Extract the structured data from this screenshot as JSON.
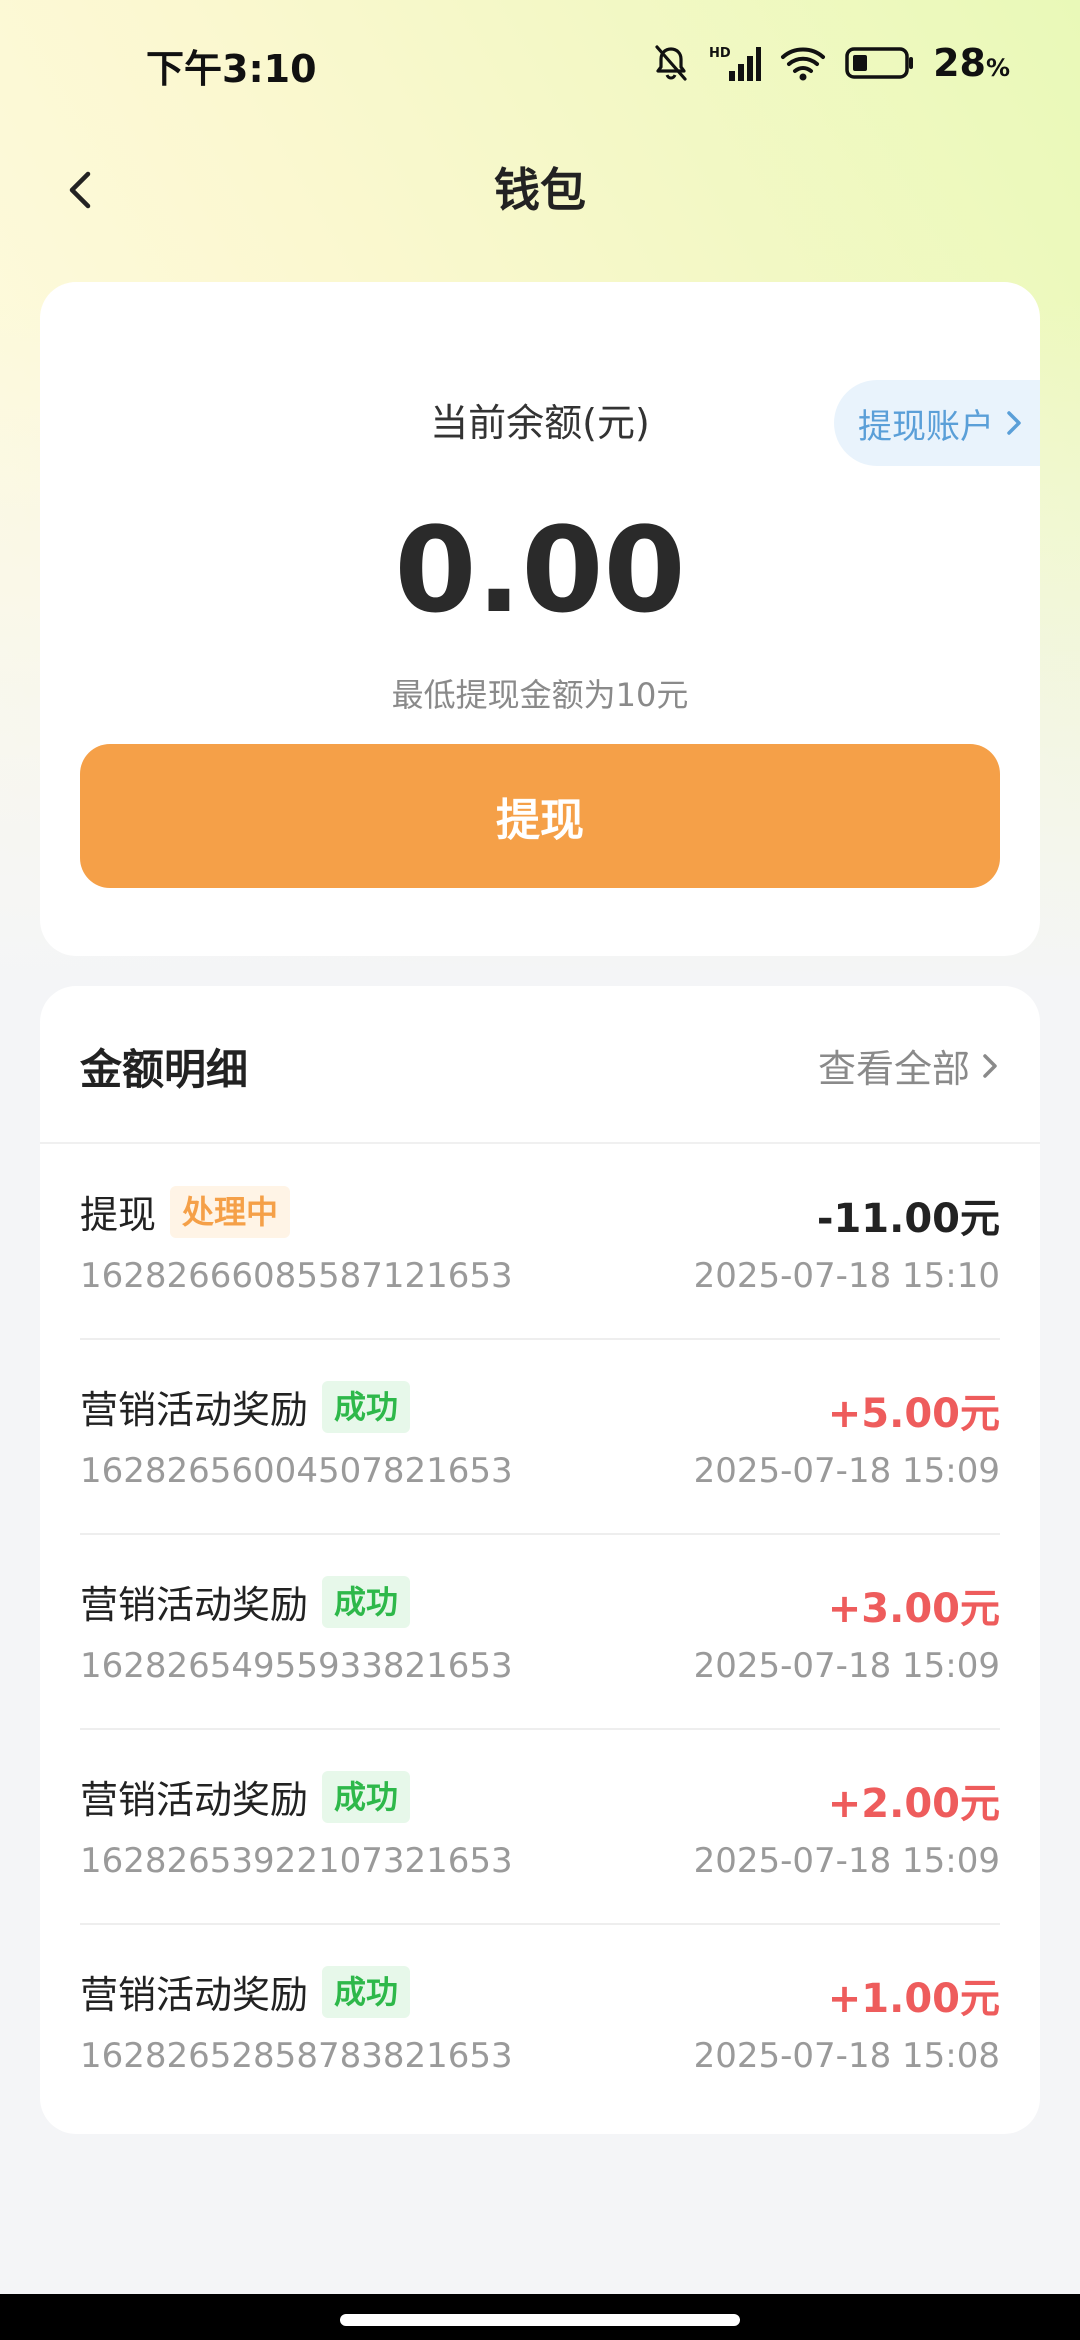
{
  "status_bar": {
    "time": "下午3:10",
    "network": "HD",
    "battery": "28",
    "battery_unit": "%"
  },
  "nav": {
    "title": "钱包"
  },
  "balance": {
    "label": "当前余额(元)",
    "value": "0.00",
    "min_withdraw_note": "最低提现金额为10元",
    "withdraw_account_label": "提现账户",
    "withdraw_button_label": "提现"
  },
  "details": {
    "title": "金额明细",
    "view_all_label": "查看全部",
    "records": [
      {
        "title": "提现",
        "status": "处理中",
        "id": "1628266608558712165​3",
        "amount": "-11.00元",
        "time": "2025-07-18 15:10"
      },
      {
        "title": "营销活动奖励",
        "status": "成功",
        "id": "1628265600450782165​3",
        "amount": "+5.00元",
        "time": "2025-07-18 15:09"
      },
      {
        "title": "营销活动奖励",
        "status": "成功",
        "id": "1628265495593382165​3",
        "amount": "+3.00元",
        "time": "2025-07-18 15:09"
      },
      {
        "title": "营销活动奖励",
        "status": "成功",
        "id": "1628265392210732165​3",
        "amount": "+2.00元",
        "time": "2025-07-18 15:09"
      },
      {
        "title": "营销活动奖励",
        "status": "成功",
        "id": "1628265285878382165​3",
        "amount": "+1.00元",
        "time": "2025-07-18 15:08"
      }
    ]
  },
  "colors": {
    "accent": "#f5a048",
    "positive_amount": "#ee5c5c",
    "success_badge": "#2eb84a",
    "link_blue": "#5a9fd8"
  },
  "icons": {
    "back": "chevron-left-icon",
    "mute": "bell-off-icon",
    "signal": "signal-icon",
    "wifi": "wifi-icon",
    "battery": "battery-icon",
    "account_chevron": "chevron-right-icon",
    "view_all_chevron": "chevron-right-icon"
  }
}
